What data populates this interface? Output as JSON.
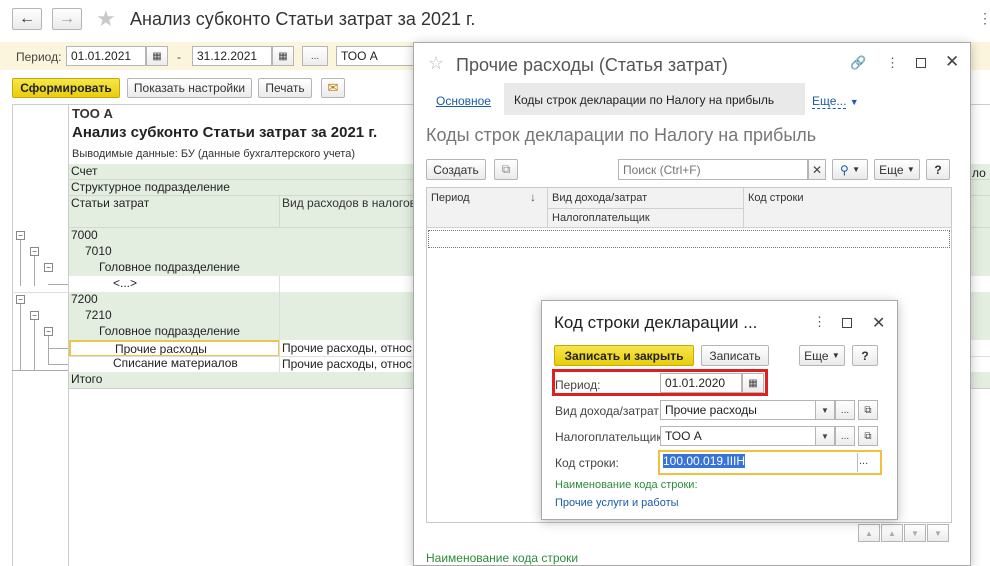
{
  "main": {
    "title": "Анализ субконто Статьи затрат  за 2021 г.",
    "period_label": "Период:",
    "period_from": "01.01.2021",
    "period_dash": "-",
    "period_to": "31.12.2021",
    "ellipsis": "...",
    "org": "ТОО А",
    "btn_generate": "Сформировать",
    "btn_settings": "Показать настройки",
    "btn_print": "Печать"
  },
  "report": {
    "org": "ТОО А",
    "title": "Анализ субконто Статьи затрат  за 2021 г.",
    "output_data": "Выводимые данные:  БУ (данные бухгалтерского учета)",
    "col_account": "Счет",
    "col_division": "Структурное подразделение",
    "col_cost_items": "Статьи затрат",
    "col_expense_type": "Вид расходов в налогов",
    "col_right_fragment": "ло",
    "rows": [
      {
        "text": "7000"
      },
      {
        "text": "7010"
      },
      {
        "text": "Головное подразделение"
      },
      {
        "text": "<...>"
      },
      {
        "text": "7200"
      },
      {
        "text": "7210"
      },
      {
        "text": "Головное подразделение"
      },
      {
        "text": "Прочие расходы",
        "col2": "Прочие расходы, относ"
      },
      {
        "text": "Списание материалов",
        "col2": "Прочие расходы, относ"
      },
      {
        "text": "Итого"
      }
    ]
  },
  "form": {
    "title": "Прочие расходы (Статья затрат)",
    "tab_main": "Основное",
    "tab_codes": "Коды строк декларации по Налогу на прибыль",
    "tab_more": "Еще...",
    "subtitle": "Коды строк декларации по Налогу на прибыль",
    "btn_create": "Создать",
    "search_placeholder": "Поиск (Ctrl+F)",
    "btn_more": "Еще",
    "btn_help": "?",
    "col_period": "Период",
    "col_income_type": "Вид дохода/затрат",
    "col_taxpayer": "Налогоплательщик",
    "col_code": "Код строки",
    "footer_label": "Наименование кода строки"
  },
  "dialog": {
    "title": "Код строки декларации ...",
    "btn_save_close": "Записать и закрыть",
    "btn_save": "Записать",
    "btn_more": "Еще",
    "btn_help": "?",
    "period_label": "Период:",
    "period_value": "01.01.2020",
    "income_label": "Вид дохода/затрат:",
    "income_value": "Прочие расходы",
    "taxpayer_label": "Налогоплательщик:",
    "taxpayer_value": "ТОО А",
    "code_label": "Код строки:",
    "code_value": "100.00.019.IIIH",
    "name_label": "Наименование кода строки:",
    "name_value": "Прочие услуги и работы"
  },
  "colors": {
    "accent_yellow": "#f0d820",
    "link_blue": "#1a5aa8",
    "green_text": "#2e8b3a",
    "highlight_red": "#e02020",
    "row_green": "#e3eee0"
  }
}
